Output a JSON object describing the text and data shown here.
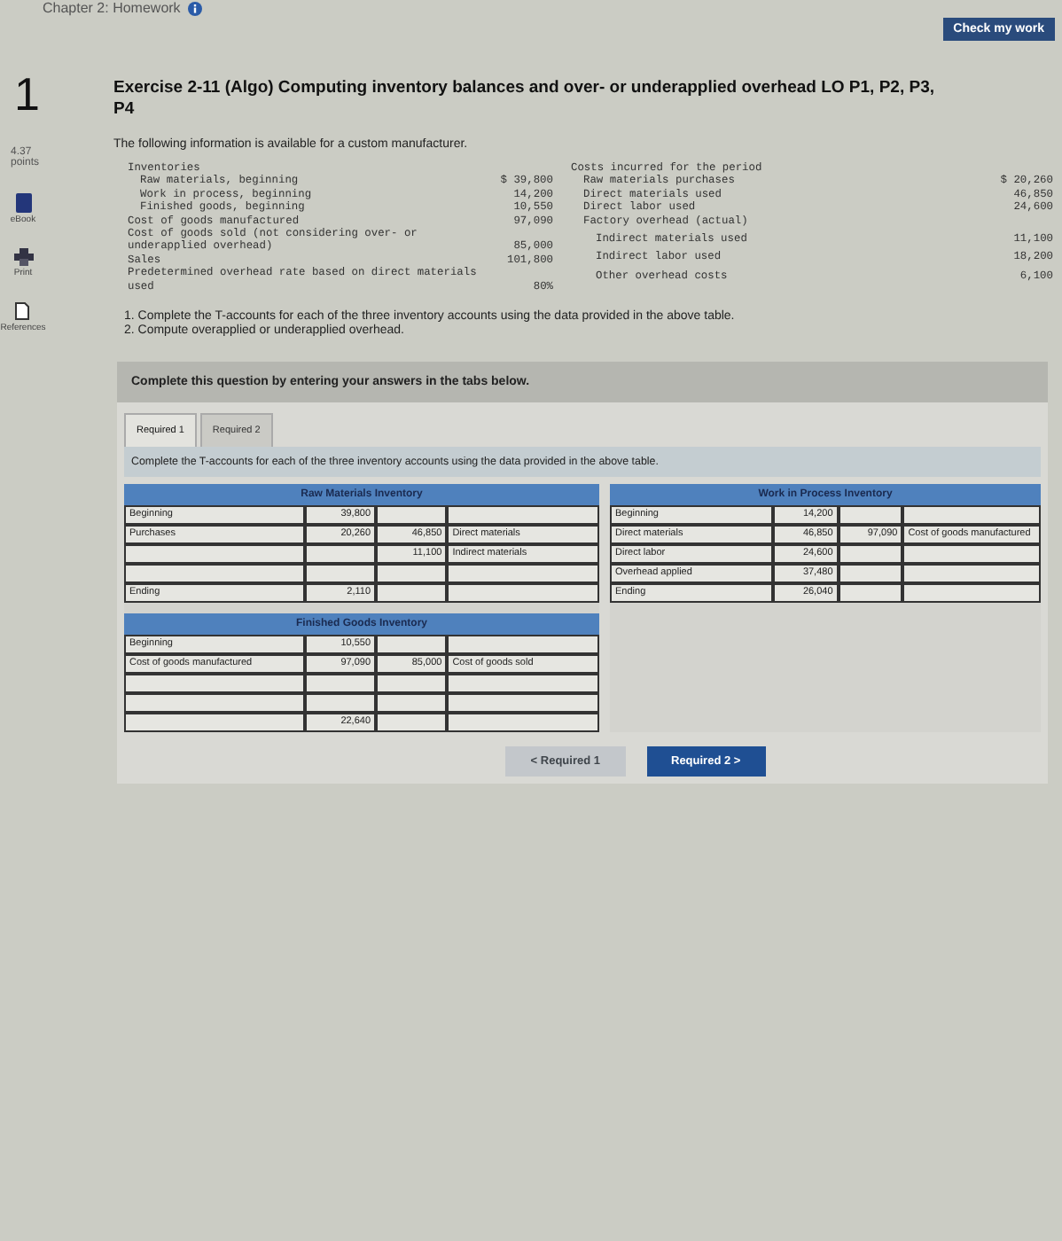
{
  "chapter_title": "Chapter 2: Homework",
  "check_button": "Check my work",
  "question": {
    "number": "1",
    "points": "4.37",
    "points_label": "points"
  },
  "tools": [
    {
      "kind": "book",
      "label": "eBook"
    },
    {
      "kind": "print",
      "label": "Print"
    },
    {
      "kind": "document",
      "label": "References"
    }
  ],
  "title": "Exercise 2-11 (Algo) Computing inventory balances and over- or underapplied overhead LO P1, P2, P3, P4",
  "intro": "The following information is available for a custom manufacturer.",
  "given": {
    "left": [
      {
        "label": "Inventories",
        "children": [
          {
            "label": "Raw materials, beginning",
            "value": "$ 39,800"
          },
          {
            "label": "Work in process, beginning",
            "value": "14,200"
          },
          {
            "label": "Finished goods, beginning",
            "value": "10,550"
          }
        ]
      },
      {
        "label": "Cost of goods manufactured",
        "value": "97,090"
      },
      {
        "label": "Cost of goods sold (not considering over- or underapplied overhead)",
        "value": "85,000"
      },
      {
        "label": "Sales",
        "value": "101,800"
      },
      {
        "label": "Predetermined overhead rate based on direct materials used",
        "value": "80%"
      }
    ],
    "right": [
      {
        "label": "Costs incurred for the period",
        "children": [
          {
            "label": "Raw materials purchases",
            "value": "$ 20,260"
          },
          {
            "label": "Direct materials used",
            "value": "46,850"
          },
          {
            "label": "Direct labor used",
            "value": "24,600"
          },
          {
            "label": "Factory overhead (actual)",
            "children": [
              {
                "label": "Indirect materials used",
                "value": "11,100"
              },
              {
                "label": "Indirect labor used",
                "value": "18,200"
              },
              {
                "label": "Other overhead costs",
                "value": "6,100"
              }
            ]
          }
        ]
      }
    ]
  },
  "instructions": [
    "1. Complete the T-accounts for each of the three inventory accounts using the data provided in the above table.",
    "2. Compute overapplied or underapplied overhead."
  ],
  "banner": "Complete this question by entering your answers in the tabs below.",
  "tabs": [
    {
      "label": "Required 1",
      "selected": true
    },
    {
      "label": "Required 2",
      "selected": false
    }
  ],
  "tab_instruction": "Complete the T-accounts for each of the three inventory accounts using the data provided in the above table.",
  "t_accounts": {
    "left": [
      {
        "title": "Raw Materials Inventory",
        "rows": [
          {
            "label": "Beginning",
            "debit": "39,800"
          },
          {
            "label": "Purchases",
            "debit": "20,260",
            "credit": "46,850",
            "credit_label": "Direct materials"
          },
          {
            "credit": "11,100",
            "credit_label": "Indirect materials"
          },
          {},
          {
            "label": "Ending",
            "debit": "2,110"
          }
        ]
      },
      {
        "title": "Finished Goods Inventory",
        "rows": [
          {
            "label": "Beginning",
            "debit": "10,550"
          },
          {
            "label": "Cost of goods manufactured",
            "debit": "97,090",
            "credit": "85,000",
            "credit_label": "Cost of goods sold"
          },
          {},
          {},
          {
            "debit": "22,640"
          }
        ]
      }
    ],
    "right": [
      {
        "title": "Work in Process Inventory",
        "rows": [
          {
            "label": "Beginning",
            "debit": "14,200"
          },
          {
            "label": "Direct materials",
            "debit": "46,850",
            "credit": "97,090",
            "credit_label": "Cost of goods manufactured"
          },
          {
            "label": "Direct labor",
            "debit": "24,600"
          },
          {
            "label": "Overhead applied",
            "debit": "37,480"
          },
          {
            "label": "Ending",
            "debit": "26,040"
          }
        ]
      }
    ]
  },
  "nav": [
    {
      "arrow": "<",
      "label": "Required 1",
      "disabled": true
    },
    {
      "arrow": ">",
      "label": "Required 2",
      "disabled": false
    }
  ]
}
